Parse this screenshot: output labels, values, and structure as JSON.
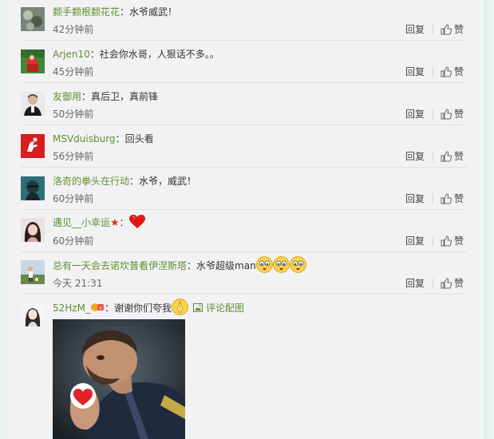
{
  "comments": [
    {
      "name": "颣手颣根颣花花",
      "separator": "：",
      "text": "水爷威武！",
      "time": "42分钟前",
      "reply": "回复",
      "like": "赞"
    },
    {
      "name": "Arjen10",
      "separator": "：",
      "text": "社会你水哥，人狠话不多。。",
      "time": "45分钟前",
      "reply": "回复",
      "like": "赞"
    },
    {
      "name": "友御用",
      "separator": "：",
      "text": "真后卫，真前锋",
      "time": "50分钟前",
      "reply": "回复",
      "like": "赞"
    },
    {
      "name": "MSVduisburg",
      "separator": "：",
      "text": "回头看",
      "time": "56分钟前",
      "reply": "回复",
      "like": "赞"
    },
    {
      "name": "洛奇的拳头在行动",
      "separator": "：",
      "text": "水爷，威武！",
      "time": "60分钟前",
      "reply": "回复",
      "like": "赞"
    },
    {
      "name": "遇见__小幸运",
      "separator": "：",
      "text": "",
      "time": "60分钟前",
      "reply": "回复",
      "like": "赞"
    },
    {
      "name": "总有一天会去诺坎普看伊涅斯塔",
      "separator": "：",
      "text": "水爷超级man",
      "time": "今天 21:31",
      "reply": "回复",
      "like": "赞"
    },
    {
      "name": "52HzM_",
      "separator": "：",
      "text": "谢谢你们夸我",
      "time": "",
      "reply": "",
      "like": "",
      "pic_link": "评论配图"
    }
  ],
  "icons": [
    "thumbs-up-icon",
    "heart-icon",
    "star-icon",
    "drool-emoji-icon",
    "image-icon",
    "pray-emoji-icon"
  ],
  "colors": {
    "name": "#5d8f2d",
    "background": "#f2f2f5",
    "page": "#eaf3f1"
  }
}
